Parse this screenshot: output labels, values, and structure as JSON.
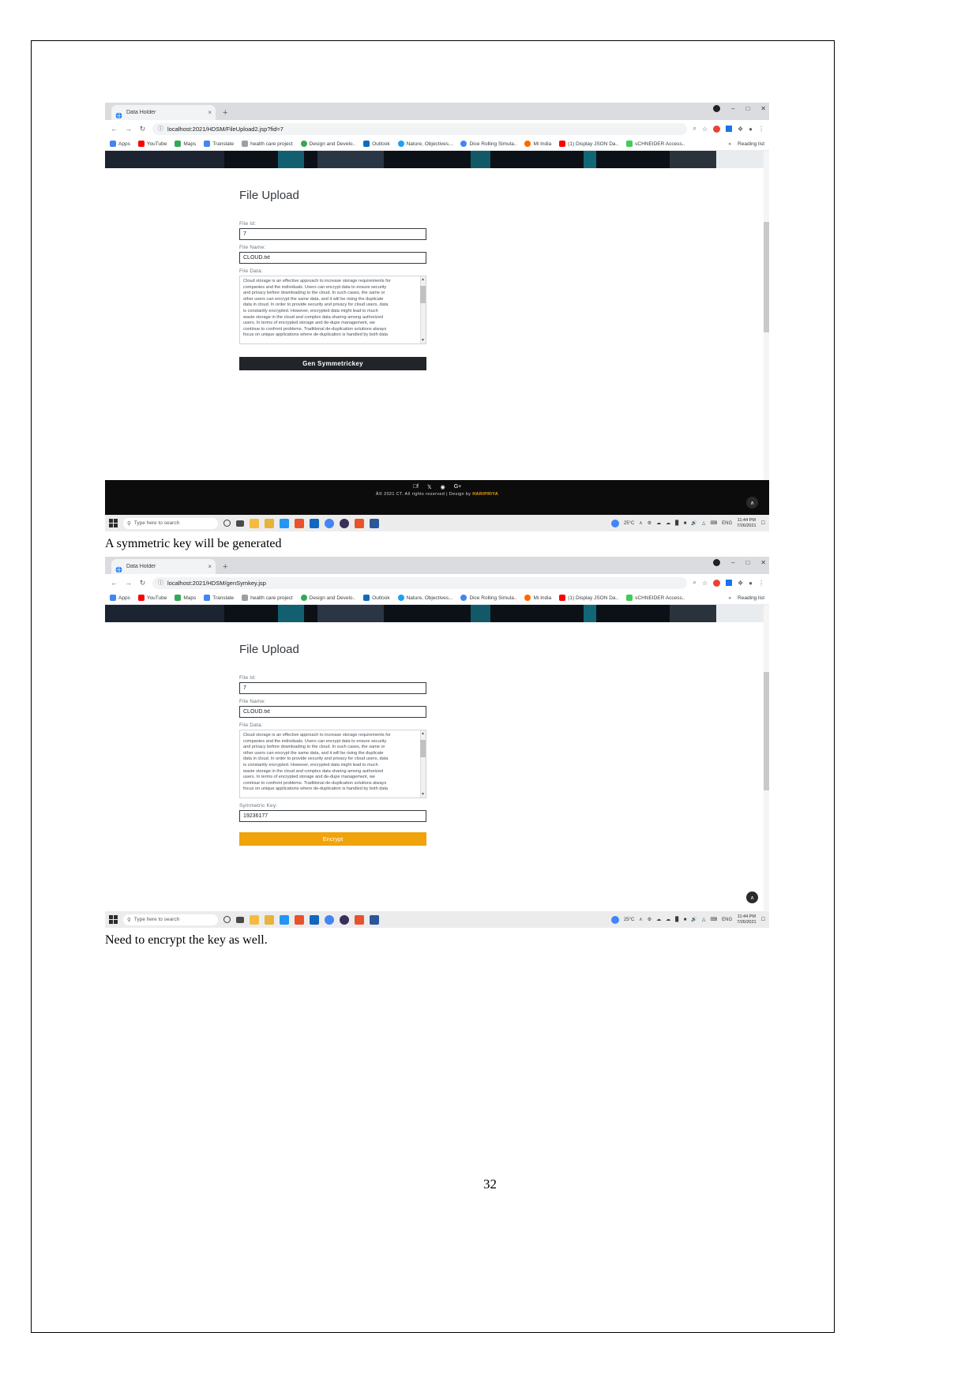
{
  "document": {
    "page_number": "32",
    "captions": {
      "after_first": "A symmetric key will be generated",
      "after_second": "Need to encrypt the key as well."
    }
  },
  "browser": {
    "tab": {
      "title": "Data Holder",
      "close": "×",
      "favicon": "globe-icon"
    },
    "new_tab": "+",
    "window_controls": {
      "profile": "•",
      "minimize": "–",
      "maximize": "□",
      "close": "✕"
    },
    "nav": {
      "back": "←",
      "forward": "→",
      "reload": "↻"
    },
    "omnibox": {
      "info_icon": "ⓘ",
      "zoom_icon": "⌕",
      "star_icon": "☆"
    },
    "toolbar_right": {
      "extensions": "❖",
      "profile": "●",
      "menu": "⋮"
    },
    "bookmarks": [
      {
        "label": "Apps",
        "color": "#4285f4"
      },
      {
        "label": "YouTube",
        "color": "#ff0000"
      },
      {
        "label": "Maps",
        "color": "#34a853"
      },
      {
        "label": "Translate",
        "color": "#4285f4"
      },
      {
        "label": "health care project",
        "color": "#9aa0a6"
      },
      {
        "label": "Design and Develo..",
        "color": "#34a853"
      },
      {
        "label": "Outlook",
        "color": "#0f6cbd"
      },
      {
        "label": "Nature, Objectives...",
        "color": "#1da1f2"
      },
      {
        "label": "Dice Rolling Simula..",
        "color": "#4285f4"
      },
      {
        "label": "Mi India",
        "color": "#ff6700"
      },
      {
        "label": "(1) Display JSON Da..",
        "color": "#ff0000"
      },
      {
        "label": "sCHNEIDER Access..",
        "color": "#3dcd58"
      }
    ],
    "bookmarks_overflow": "»",
    "reading_list": "Reading list"
  },
  "screenshot1": {
    "url": "localhost:2021/HDSM/FileUpload2.jsp?fid=7",
    "heading": "File Upload",
    "fields": {
      "file_id_label": "File Id:",
      "file_id_value": "7",
      "file_name_label": "File Name:",
      "file_name_value": "CLOUD.txt",
      "file_data_label": "File Data:"
    },
    "file_data_lines": [
      "Cloud storage is an effective approach to increase storage requirements for",
      "companies and the individuals. Users can encrypt data to ensure security",
      "and privacy before downloading to the cloud. In such cases, the same or",
      "other users can encrypt the same data, and it will be rising the duplicate",
      "data in cloud. In order to provide security and privacy for cloud users, data",
      "is constantly encrypted. However, encrypted data might lead to much",
      "waste storage in the cloud and complex data sharing among authorized",
      "users. In terms of encrypted storage and de-dupe management, we",
      "continue to confront problems. Traditional de-duplication solutions always",
      "focus on unique applications where de-duplication is handled by both data"
    ],
    "submit_button": "Gen Symmetrickey",
    "footer": {
      "social": [
        "facebook-icon",
        "twitter-icon",
        "dribbble-icon",
        "google-plus-icon"
      ],
      "copyright": "Â© 2021 CT. All rights reserved | Design by ",
      "designer": "HARIPRIYA",
      "to_top": "∧"
    }
  },
  "screenshot2": {
    "url": "localhost:2021/HDSM/genSymkey.jsp",
    "heading": "File Upload",
    "fields": {
      "file_id_label": "File Id:",
      "file_id_value": "7",
      "file_name_label": "File Name:",
      "file_name_value": "CLOUD.txt",
      "file_data_label": "File Data:",
      "symmetric_key_label": "Symmetric Key:",
      "symmetric_key_value": "19236177"
    },
    "file_data_lines": [
      "Cloud storage is an effective approach to increase storage requirements for",
      "companies and the individuals. Users can encrypt data to ensure security",
      "and privacy before downloading to the cloud. In such cases, the same or",
      "other users can encrypt the same data, and it will be rising the duplicate",
      "data in cloud. In order to provide security and privacy for cloud users, data",
      "is constantly encrypted. However, encrypted data might lead to much",
      "waste storage in the cloud and complex data sharing among authorized",
      "users. In terms of encrypted storage and de-dupe management, we",
      "continue to confront problems. Traditional de-duplication solutions always",
      "focus on unique applications where de-duplication is handled by both data"
    ],
    "submit_button": "Encrypt",
    "to_top": "∧"
  },
  "taskbar": {
    "start": "windows-start-icon",
    "search_placeholder": "Type here to search",
    "search_icon": "search-icon",
    "cortana": "cortana-icon",
    "task_view": "task-view-icon",
    "pinned": [
      "file-explorer-icon",
      "store-icon",
      "photos-icon",
      "office-icon",
      "mail-icon",
      "chrome-icon",
      "opera-icon",
      "paint-icon",
      "word-icon"
    ],
    "tray": {
      "weather_temp": "25°C",
      "show_hidden": "∧",
      "network": "network-icon",
      "cloud": "cloud-icon",
      "onedrive": "onedrive-icon",
      "battery": "battery-icon",
      "volume": "volume-icon",
      "language": "ENG",
      "time": "11:44 PM",
      "date": "7/26/2021",
      "notifications": "notification-icon"
    }
  }
}
